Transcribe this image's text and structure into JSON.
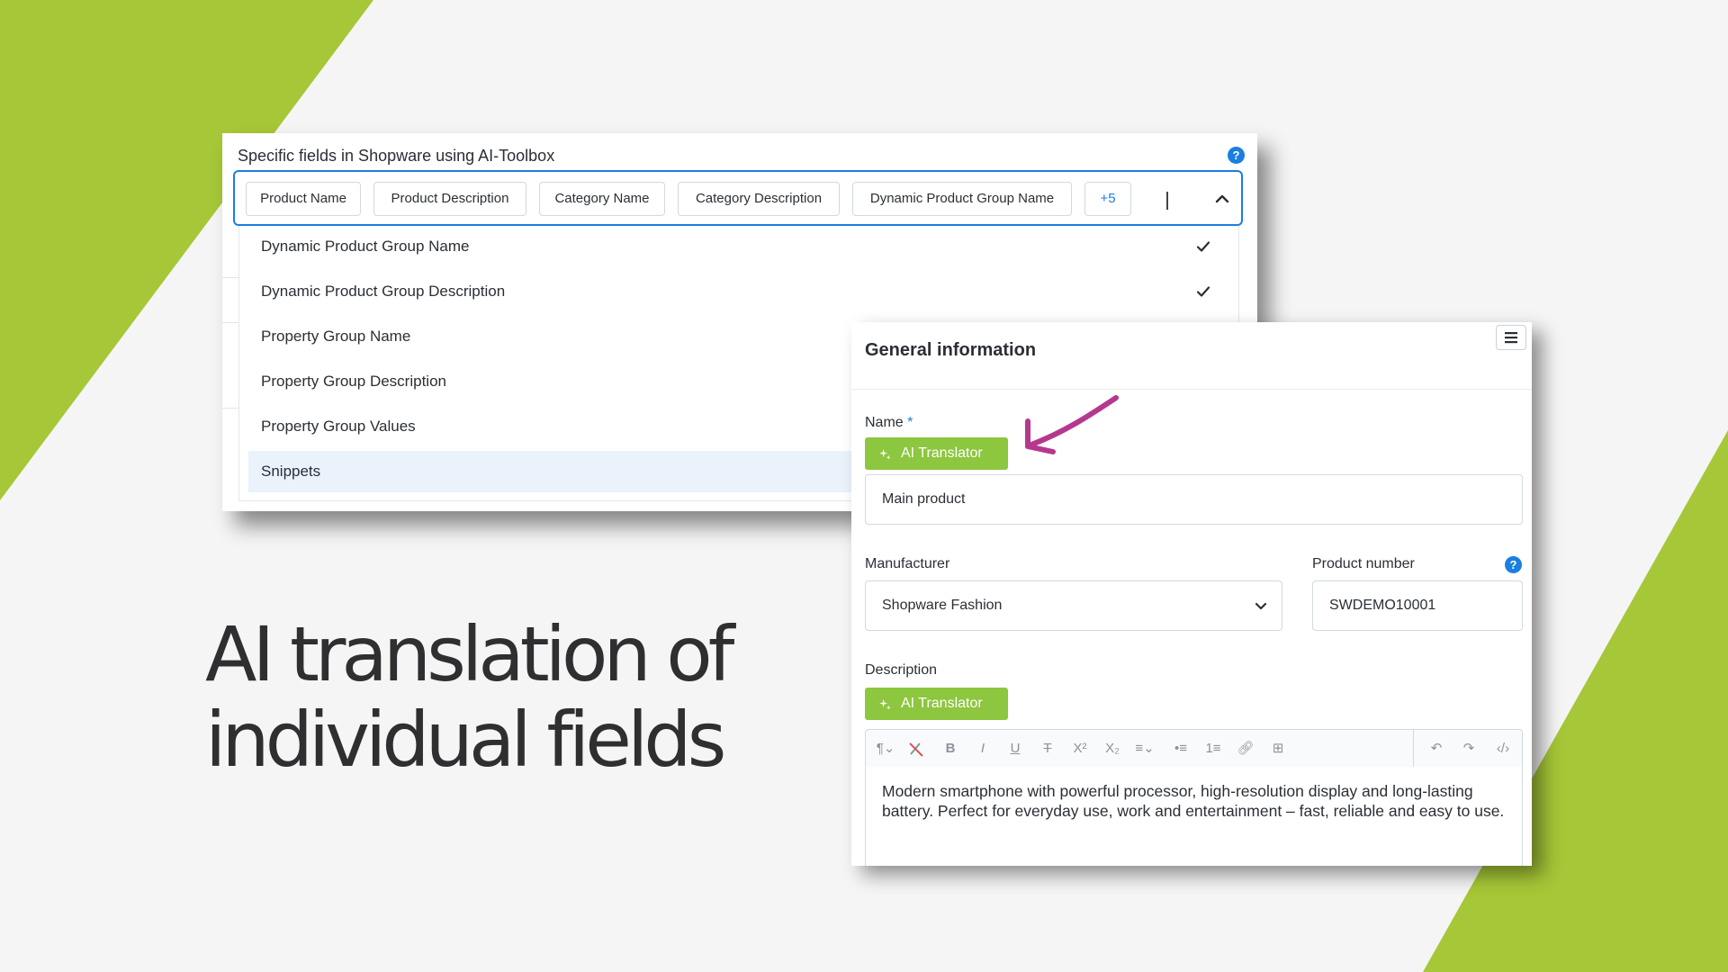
{
  "colors": {
    "accent_green": "#8dc63f",
    "bg_green": "#a6c737",
    "primary_blue": "#1a7fe0",
    "arrow_magenta": "#b5388f"
  },
  "headline": {
    "line1": "AI translation of",
    "line2": "individual fields"
  },
  "field_select": {
    "label": "Specific fields in Shopware using AI-Toolbox",
    "help_icon": "?",
    "chips": [
      "Product Name",
      "Product Description",
      "Category Name",
      "Category Description",
      "Dynamic Product Group Name"
    ],
    "more_chip": "+5",
    "options": [
      {
        "label": "Dynamic Product Group Name",
        "selected": true
      },
      {
        "label": "Dynamic Product Group Description",
        "selected": true
      },
      {
        "label": "Property Group Name",
        "selected": false
      },
      {
        "label": "Property Group Description",
        "selected": false
      },
      {
        "label": "Property Group Values",
        "selected": false
      },
      {
        "label": "Snippets",
        "selected": false,
        "highlighted": true
      }
    ]
  },
  "general_info": {
    "title": "General information",
    "name_label": "Name",
    "required_mark": "*",
    "ai_button_label": "AI Translator",
    "name_value": "Main product",
    "manufacturer_label": "Manufacturer",
    "manufacturer_value": "Shopware Fashion",
    "product_number_label": "Product number",
    "product_number_help": "?",
    "product_number_value": "SWDEMO10001",
    "description_label": "Description",
    "description_ai_button_label": "AI Translator",
    "description_text": "Modern smartphone with powerful processor, high-resolution display and long-lasting battery. Perfect for everyday use, work and entertainment – fast, reliable and easy to use.",
    "toolbar_icons": [
      "paragraph-format-icon",
      "clear-format-icon",
      "bold-icon",
      "italic-icon",
      "underline-icon",
      "strikethrough-icon",
      "superscript-icon",
      "subscript-icon",
      "align-icon",
      "bullet-list-icon",
      "numbered-list-icon",
      "link-icon",
      "table-icon",
      "undo-icon",
      "redo-icon",
      "code-view-icon"
    ]
  }
}
